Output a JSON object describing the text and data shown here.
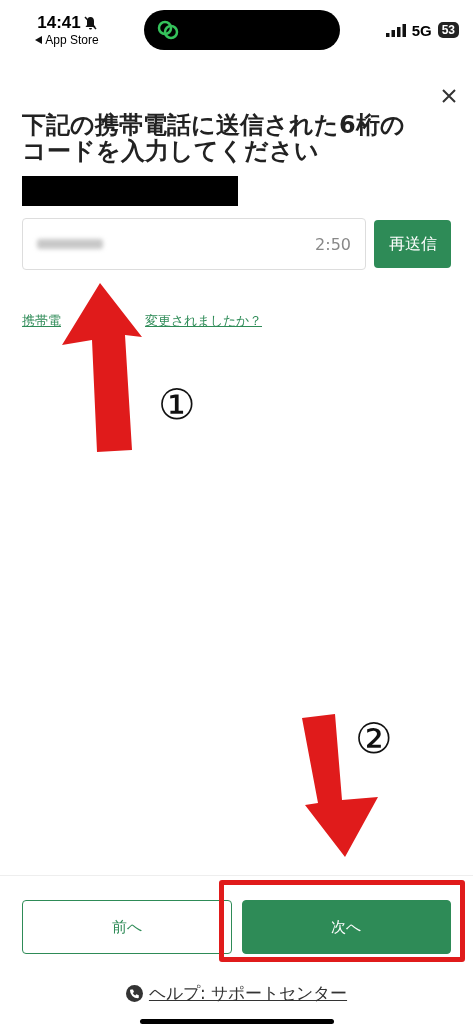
{
  "status_bar": {
    "time": "14:41",
    "back_label": "App Store",
    "network": "5G",
    "battery": "53"
  },
  "title": "下記の携帯電話に送信された6桁のコードを入力してください",
  "code_field": {
    "timer": "2:50"
  },
  "resend_button": "再送信",
  "phone_link_parts": [
    "携帯電",
    "変更されましたか？"
  ],
  "buttons": [
    {
      "label": "前へ",
      "kind": "secondary"
    },
    {
      "label": "次へ",
      "kind": "primary"
    }
  ],
  "help_link": "ヘルプ: サポートセンター",
  "annotations": [
    {
      "label": "①"
    },
    {
      "label": "②"
    }
  ]
}
